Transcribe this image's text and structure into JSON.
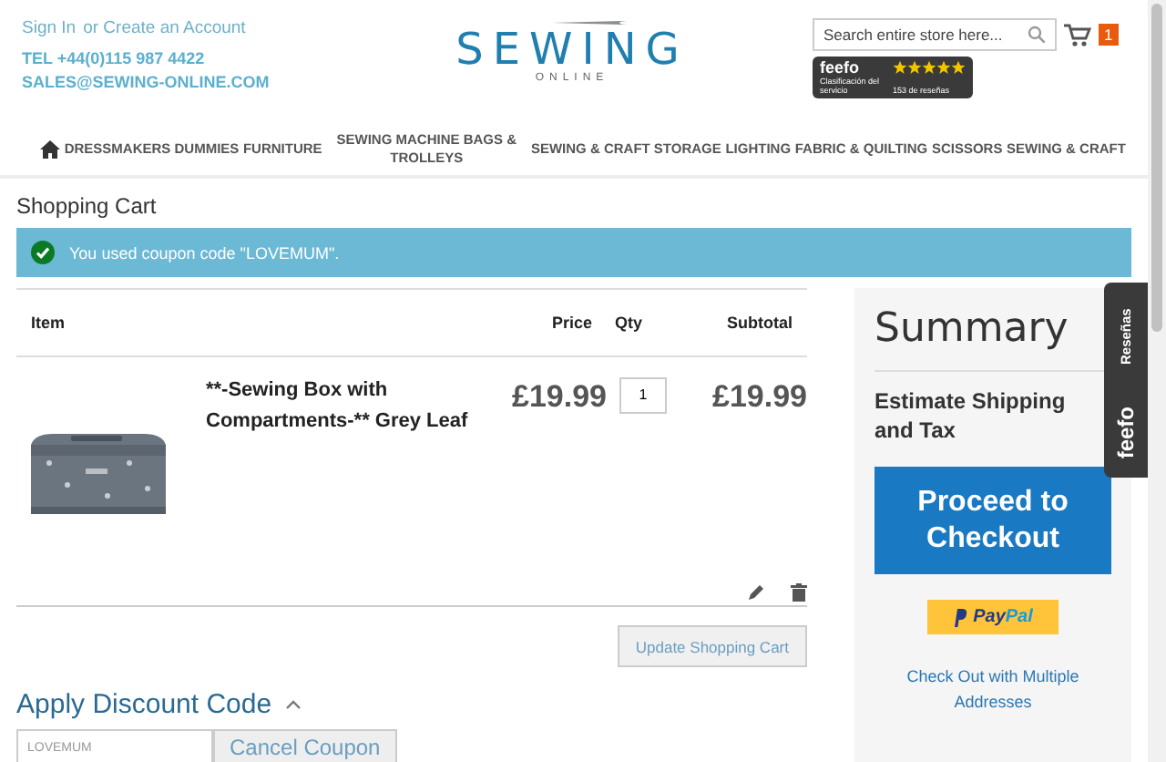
{
  "header": {
    "sign_in": "Sign In",
    "create_account": "or Create an Account",
    "phone": "TEL +44(0)115 987 4422",
    "email": "SALES@SEWING-ONLINE.COM",
    "logo": {
      "name": "SEWING",
      "tagline": "ONLINE"
    },
    "search": {
      "placeholder": "Search entire store here..."
    },
    "cart_count": "1",
    "feefo": {
      "brand": "feefo",
      "caption": "Clasificación del servicio",
      "stars": 5,
      "reviews": "153 de reseñas"
    }
  },
  "nav": [
    {
      "kind": "home"
    },
    {
      "kind": "link",
      "label": "DRESSMAKERS DUMMIES"
    },
    {
      "kind": "link",
      "label": "FURNITURE"
    },
    {
      "kind": "link",
      "label": "SEWING MACHINE BAGS & TROLLEYS"
    },
    {
      "kind": "link",
      "label": "SEWING & CRAFT STORAGE"
    },
    {
      "kind": "link",
      "label": "LIGHTING"
    },
    {
      "kind": "link",
      "label": "FABRIC & QUILTING"
    },
    {
      "kind": "link",
      "label": "SCISSORS"
    },
    {
      "kind": "link",
      "label": "SEWING & CRAFT"
    }
  ],
  "page_title": "Shopping Cart",
  "message": "You used coupon code \"LOVEMUM\".",
  "table": {
    "columns": [
      "Item",
      "Price",
      "Qty",
      "Subtotal"
    ],
    "rows": [
      {
        "name": "**-Sewing Box with Compartments-** Grey Leaf",
        "price": "£19.99",
        "qty": "1",
        "subtotal": "£19.99"
      }
    ]
  },
  "update_button": "Update Shopping Cart",
  "discount": {
    "title": "Apply Discount Code",
    "expanded": true,
    "code": "LOVEMUM",
    "button": "Cancel Coupon"
  },
  "summary": {
    "title": "Summary",
    "estimate": "Estimate Shipping and Tax",
    "checkout": "Proceed to Checkout",
    "paypal_a": "Pay",
    "paypal_b": "Pal",
    "multi": "Check Out with Multiple Addresses"
  },
  "feefo_tab": {
    "brand": "feefo",
    "label": "Reseñas"
  }
}
